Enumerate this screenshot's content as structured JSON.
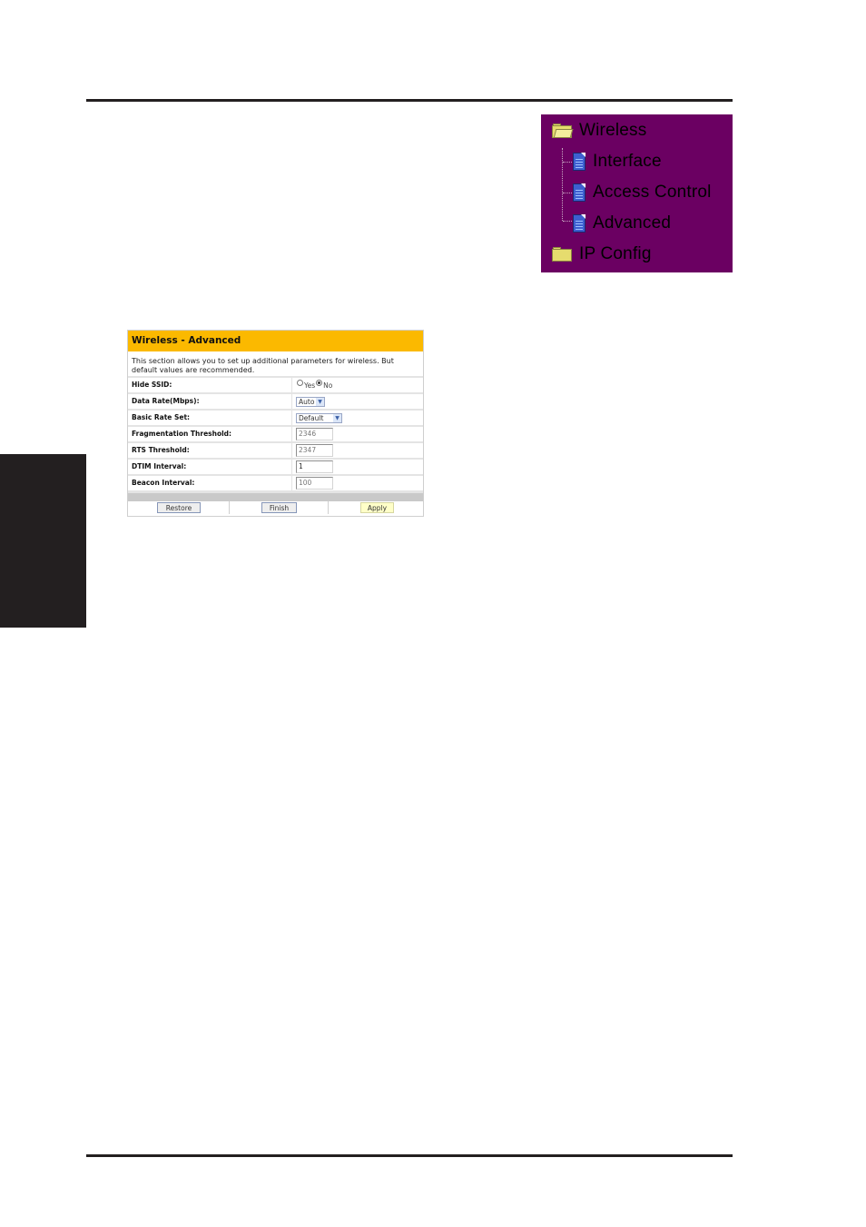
{
  "page": {
    "rules": [
      "top",
      "bottom"
    ],
    "side_tab_color": "#231f20"
  },
  "nav_tree": {
    "background": "#6b0062",
    "items": [
      {
        "label": "Wireless",
        "icon": "folder-open-icon",
        "level": 0
      },
      {
        "label": "Interface",
        "icon": "document-icon",
        "level": 1
      },
      {
        "label": "Access Control",
        "icon": "document-icon",
        "level": 1
      },
      {
        "label": "Advanced",
        "icon": "document-icon",
        "level": 1
      },
      {
        "label": "IP Config",
        "icon": "folder-closed-icon",
        "level": 0
      }
    ]
  },
  "panel": {
    "title": "Wireless - Advanced",
    "header_color": "#fbb900",
    "description": "This section allows you to set up additional parameters for wireless. But default values are recommended.",
    "fields": {
      "hide_ssid": {
        "label": "Hide SSID:",
        "options": [
          "Yes",
          "No"
        ],
        "selected": "No"
      },
      "data_rate": {
        "label": "Data Rate(Mbps):",
        "value": "Auto"
      },
      "basic_rate_set": {
        "label": "Basic Rate Set:",
        "value": "Default"
      },
      "fragmentation_threshold": {
        "label": "Fragmentation Threshold:",
        "value": "2346"
      },
      "rts_threshold": {
        "label": "RTS Threshold:",
        "value": "2347"
      },
      "dtim_interval": {
        "label": "DTIM Interval:",
        "value": "1"
      },
      "beacon_interval": {
        "label": "Beacon Interval:",
        "value": "100"
      }
    },
    "buttons": {
      "restore": "Restore",
      "finish": "Finish",
      "apply": "Apply"
    }
  }
}
